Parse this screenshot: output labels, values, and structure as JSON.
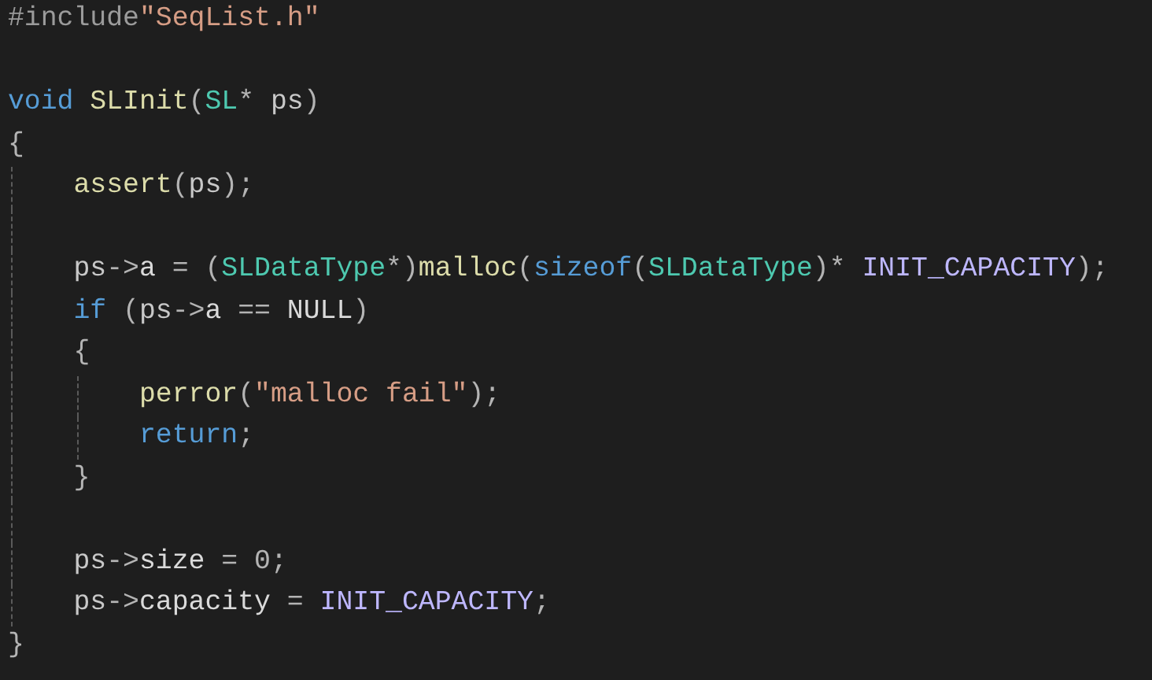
{
  "lines": [
    {
      "kind": "code",
      "tokens": [
        {
          "kind": "preproc",
          "text": "#include"
        },
        {
          "kind": "string",
          "text": "\"SeqList.h\""
        }
      ]
    },
    {
      "kind": "blank"
    },
    {
      "kind": "code",
      "tokens": [
        {
          "kind": "keyword",
          "text": "void"
        },
        {
          "kind": "func",
          "text": "SLInit",
          "space_before": true
        },
        {
          "kind": "punct",
          "text": "("
        },
        {
          "kind": "type",
          "text": "SL"
        },
        {
          "kind": "punct",
          "text": "* "
        },
        {
          "kind": "param",
          "text": "ps"
        },
        {
          "kind": "punct",
          "text": ")"
        }
      ]
    },
    {
      "kind": "code",
      "tokens": [
        {
          "kind": "punct",
          "text": "{"
        }
      ]
    },
    {
      "kind": "code",
      "tokens": [
        {
          "kind": "indent"
        },
        {
          "kind": "func",
          "text": "assert"
        },
        {
          "kind": "punct",
          "text": "("
        },
        {
          "kind": "param",
          "text": "ps"
        },
        {
          "kind": "punct",
          "text": ");"
        }
      ]
    },
    {
      "kind": "guide"
    },
    {
      "kind": "code",
      "tokens": [
        {
          "kind": "indent"
        },
        {
          "kind": "param",
          "text": "ps"
        },
        {
          "kind": "punct",
          "text": "->"
        },
        {
          "kind": "plain",
          "text": "a"
        },
        {
          "kind": "punct",
          "text": " = ("
        },
        {
          "kind": "type",
          "text": "SLDataType"
        },
        {
          "kind": "punct",
          "text": "*)"
        },
        {
          "kind": "func",
          "text": "malloc"
        },
        {
          "kind": "punct",
          "text": "("
        },
        {
          "kind": "keyword",
          "text": "sizeof"
        },
        {
          "kind": "punct",
          "text": "("
        },
        {
          "kind": "type",
          "text": "SLDataType"
        },
        {
          "kind": "punct",
          "text": ")* "
        },
        {
          "kind": "macro",
          "text": "INIT_CAPACITY"
        },
        {
          "kind": "punct",
          "text": ");"
        }
      ]
    },
    {
      "kind": "code",
      "tokens": [
        {
          "kind": "indent"
        },
        {
          "kind": "keyword",
          "text": "if"
        },
        {
          "kind": "punct",
          "text": " ("
        },
        {
          "kind": "param",
          "text": "ps"
        },
        {
          "kind": "punct",
          "text": "->"
        },
        {
          "kind": "plain",
          "text": "a"
        },
        {
          "kind": "punct",
          "text": " == "
        },
        {
          "kind": "plain",
          "text": "NULL"
        },
        {
          "kind": "punct",
          "text": ")"
        }
      ]
    },
    {
      "kind": "code",
      "tokens": [
        {
          "kind": "indent"
        },
        {
          "kind": "punct",
          "text": "{"
        }
      ]
    },
    {
      "kind": "code",
      "tokens": [
        {
          "kind": "indent"
        },
        {
          "kind": "indent"
        },
        {
          "kind": "func",
          "text": "perror"
        },
        {
          "kind": "punct",
          "text": "("
        },
        {
          "kind": "string",
          "text": "\"malloc fail\""
        },
        {
          "kind": "punct",
          "text": ");"
        }
      ]
    },
    {
      "kind": "code",
      "tokens": [
        {
          "kind": "indent"
        },
        {
          "kind": "indent"
        },
        {
          "kind": "keyword",
          "text": "return"
        },
        {
          "kind": "punct",
          "text": ";"
        }
      ]
    },
    {
      "kind": "code",
      "tokens": [
        {
          "kind": "indent"
        },
        {
          "kind": "punct",
          "text": "}"
        }
      ]
    },
    {
      "kind": "guide"
    },
    {
      "kind": "code",
      "tokens": [
        {
          "kind": "indent"
        },
        {
          "kind": "param",
          "text": "ps"
        },
        {
          "kind": "punct",
          "text": "->"
        },
        {
          "kind": "plain",
          "text": "size"
        },
        {
          "kind": "punct",
          "text": " = 0;"
        }
      ]
    },
    {
      "kind": "code",
      "tokens": [
        {
          "kind": "indent"
        },
        {
          "kind": "param",
          "text": "ps"
        },
        {
          "kind": "punct",
          "text": "->"
        },
        {
          "kind": "plain",
          "text": "capacity"
        },
        {
          "kind": "punct",
          "text": " = "
        },
        {
          "kind": "macro",
          "text": "INIT_CAPACITY"
        },
        {
          "kind": "punct",
          "text": ";"
        }
      ]
    },
    {
      "kind": "code",
      "tokens": [
        {
          "kind": "punct",
          "text": "}"
        }
      ]
    }
  ]
}
